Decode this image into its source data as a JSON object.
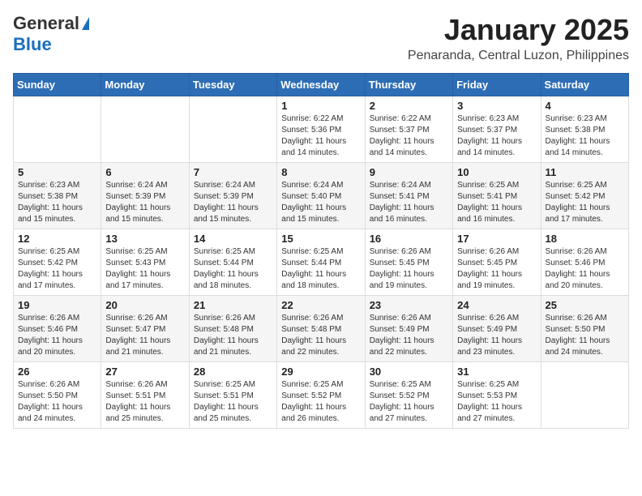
{
  "logo": {
    "line1": "General",
    "line2": "Blue"
  },
  "header": {
    "month": "January 2025",
    "location": "Penaranda, Central Luzon, Philippines"
  },
  "weekdays": [
    "Sunday",
    "Monday",
    "Tuesday",
    "Wednesday",
    "Thursday",
    "Friday",
    "Saturday"
  ],
  "weeks": [
    [
      {
        "day": "",
        "sunrise": "",
        "sunset": "",
        "daylight": ""
      },
      {
        "day": "",
        "sunrise": "",
        "sunset": "",
        "daylight": ""
      },
      {
        "day": "",
        "sunrise": "",
        "sunset": "",
        "daylight": ""
      },
      {
        "day": "1",
        "sunrise": "6:22 AM",
        "sunset": "5:36 PM",
        "daylight": "11 hours and 14 minutes."
      },
      {
        "day": "2",
        "sunrise": "6:22 AM",
        "sunset": "5:37 PM",
        "daylight": "11 hours and 14 minutes."
      },
      {
        "day": "3",
        "sunrise": "6:23 AM",
        "sunset": "5:37 PM",
        "daylight": "11 hours and 14 minutes."
      },
      {
        "day": "4",
        "sunrise": "6:23 AM",
        "sunset": "5:38 PM",
        "daylight": "11 hours and 14 minutes."
      }
    ],
    [
      {
        "day": "5",
        "sunrise": "6:23 AM",
        "sunset": "5:38 PM",
        "daylight": "11 hours and 15 minutes."
      },
      {
        "day": "6",
        "sunrise": "6:24 AM",
        "sunset": "5:39 PM",
        "daylight": "11 hours and 15 minutes."
      },
      {
        "day": "7",
        "sunrise": "6:24 AM",
        "sunset": "5:39 PM",
        "daylight": "11 hours and 15 minutes."
      },
      {
        "day": "8",
        "sunrise": "6:24 AM",
        "sunset": "5:40 PM",
        "daylight": "11 hours and 15 minutes."
      },
      {
        "day": "9",
        "sunrise": "6:24 AM",
        "sunset": "5:41 PM",
        "daylight": "11 hours and 16 minutes."
      },
      {
        "day": "10",
        "sunrise": "6:25 AM",
        "sunset": "5:41 PM",
        "daylight": "11 hours and 16 minutes."
      },
      {
        "day": "11",
        "sunrise": "6:25 AM",
        "sunset": "5:42 PM",
        "daylight": "11 hours and 17 minutes."
      }
    ],
    [
      {
        "day": "12",
        "sunrise": "6:25 AM",
        "sunset": "5:42 PM",
        "daylight": "11 hours and 17 minutes."
      },
      {
        "day": "13",
        "sunrise": "6:25 AM",
        "sunset": "5:43 PM",
        "daylight": "11 hours and 17 minutes."
      },
      {
        "day": "14",
        "sunrise": "6:25 AM",
        "sunset": "5:44 PM",
        "daylight": "11 hours and 18 minutes."
      },
      {
        "day": "15",
        "sunrise": "6:25 AM",
        "sunset": "5:44 PM",
        "daylight": "11 hours and 18 minutes."
      },
      {
        "day": "16",
        "sunrise": "6:26 AM",
        "sunset": "5:45 PM",
        "daylight": "11 hours and 19 minutes."
      },
      {
        "day": "17",
        "sunrise": "6:26 AM",
        "sunset": "5:45 PM",
        "daylight": "11 hours and 19 minutes."
      },
      {
        "day": "18",
        "sunrise": "6:26 AM",
        "sunset": "5:46 PM",
        "daylight": "11 hours and 20 minutes."
      }
    ],
    [
      {
        "day": "19",
        "sunrise": "6:26 AM",
        "sunset": "5:46 PM",
        "daylight": "11 hours and 20 minutes."
      },
      {
        "day": "20",
        "sunrise": "6:26 AM",
        "sunset": "5:47 PM",
        "daylight": "11 hours and 21 minutes."
      },
      {
        "day": "21",
        "sunrise": "6:26 AM",
        "sunset": "5:48 PM",
        "daylight": "11 hours and 21 minutes."
      },
      {
        "day": "22",
        "sunrise": "6:26 AM",
        "sunset": "5:48 PM",
        "daylight": "11 hours and 22 minutes."
      },
      {
        "day": "23",
        "sunrise": "6:26 AM",
        "sunset": "5:49 PM",
        "daylight": "11 hours and 22 minutes."
      },
      {
        "day": "24",
        "sunrise": "6:26 AM",
        "sunset": "5:49 PM",
        "daylight": "11 hours and 23 minutes."
      },
      {
        "day": "25",
        "sunrise": "6:26 AM",
        "sunset": "5:50 PM",
        "daylight": "11 hours and 24 minutes."
      }
    ],
    [
      {
        "day": "26",
        "sunrise": "6:26 AM",
        "sunset": "5:50 PM",
        "daylight": "11 hours and 24 minutes."
      },
      {
        "day": "27",
        "sunrise": "6:26 AM",
        "sunset": "5:51 PM",
        "daylight": "11 hours and 25 minutes."
      },
      {
        "day": "28",
        "sunrise": "6:25 AM",
        "sunset": "5:51 PM",
        "daylight": "11 hours and 25 minutes."
      },
      {
        "day": "29",
        "sunrise": "6:25 AM",
        "sunset": "5:52 PM",
        "daylight": "11 hours and 26 minutes."
      },
      {
        "day": "30",
        "sunrise": "6:25 AM",
        "sunset": "5:52 PM",
        "daylight": "11 hours and 27 minutes."
      },
      {
        "day": "31",
        "sunrise": "6:25 AM",
        "sunset": "5:53 PM",
        "daylight": "11 hours and 27 minutes."
      },
      {
        "day": "",
        "sunrise": "",
        "sunset": "",
        "daylight": ""
      }
    ]
  ],
  "labels": {
    "sunrise": "Sunrise:",
    "sunset": "Sunset:",
    "daylight": "Daylight:"
  }
}
